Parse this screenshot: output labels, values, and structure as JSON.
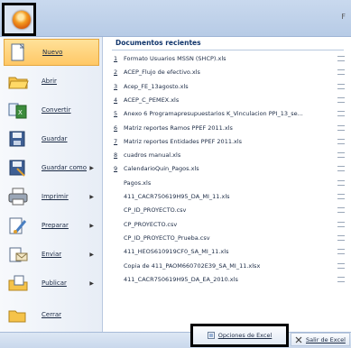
{
  "window": {
    "title_fragment": "F"
  },
  "left_menu": {
    "items": [
      {
        "label": "Nuevo",
        "has_arrow": false,
        "selected": true
      },
      {
        "label": "Abrir",
        "has_arrow": false
      },
      {
        "label": "Convertir",
        "has_arrow": false
      },
      {
        "label": "Guardar",
        "has_arrow": false
      },
      {
        "label": "Guardar como",
        "has_arrow": true
      },
      {
        "label": "Imprimir",
        "has_arrow": true
      },
      {
        "label": "Preparar",
        "has_arrow": true
      },
      {
        "label": "Enviar",
        "has_arrow": true
      },
      {
        "label": "Publicar",
        "has_arrow": true
      },
      {
        "label": "Cerrar",
        "has_arrow": false
      }
    ]
  },
  "recent": {
    "title": "Documentos recientes",
    "docs": [
      {
        "num": "1",
        "name": "Formato Usuarios MSSN (SHCP).xls"
      },
      {
        "num": "2",
        "name": "ACEP_Flujo de efectivo.xls"
      },
      {
        "num": "3",
        "name": "Acep_FE_13agosto.xls"
      },
      {
        "num": "4",
        "name": "ACEP_C_PEMEX.xls"
      },
      {
        "num": "5",
        "name": "Anexo 6 Programapresupuestarios K_Vinculacion PPI_13_se..."
      },
      {
        "num": "6",
        "name": "Matriz reportes Ramos PPEF 2011.xls"
      },
      {
        "num": "7",
        "name": "Matriz reportes Entidades PPEF 2011.xls"
      },
      {
        "num": "8",
        "name": "cuadros manual.xls"
      },
      {
        "num": "9",
        "name": "CalendarioQuin_Pagos.xls"
      },
      {
        "num": "",
        "name": "Pagos.xls"
      },
      {
        "num": "",
        "name": "411_CACR750619H95_DA_MI_11.xls"
      },
      {
        "num": "",
        "name": "CP_ID_PROYECTO.csv"
      },
      {
        "num": "",
        "name": "CP_PROYECTO.csv"
      },
      {
        "num": "",
        "name": "CP_ID_PROYECTO_Prueba.csv"
      },
      {
        "num": "",
        "name": "411_HEOS610919CF0_SA_MI_11.xls"
      },
      {
        "num": "",
        "name": "Copia de 411_PAOM660702E39_SA_MI_11.xlsx"
      },
      {
        "num": "",
        "name": "411_CACR750619H95_DA_EA_2010.xls"
      }
    ]
  },
  "bottom": {
    "options_label": "Opciones de Excel",
    "exit_label": "Salir de Excel"
  }
}
